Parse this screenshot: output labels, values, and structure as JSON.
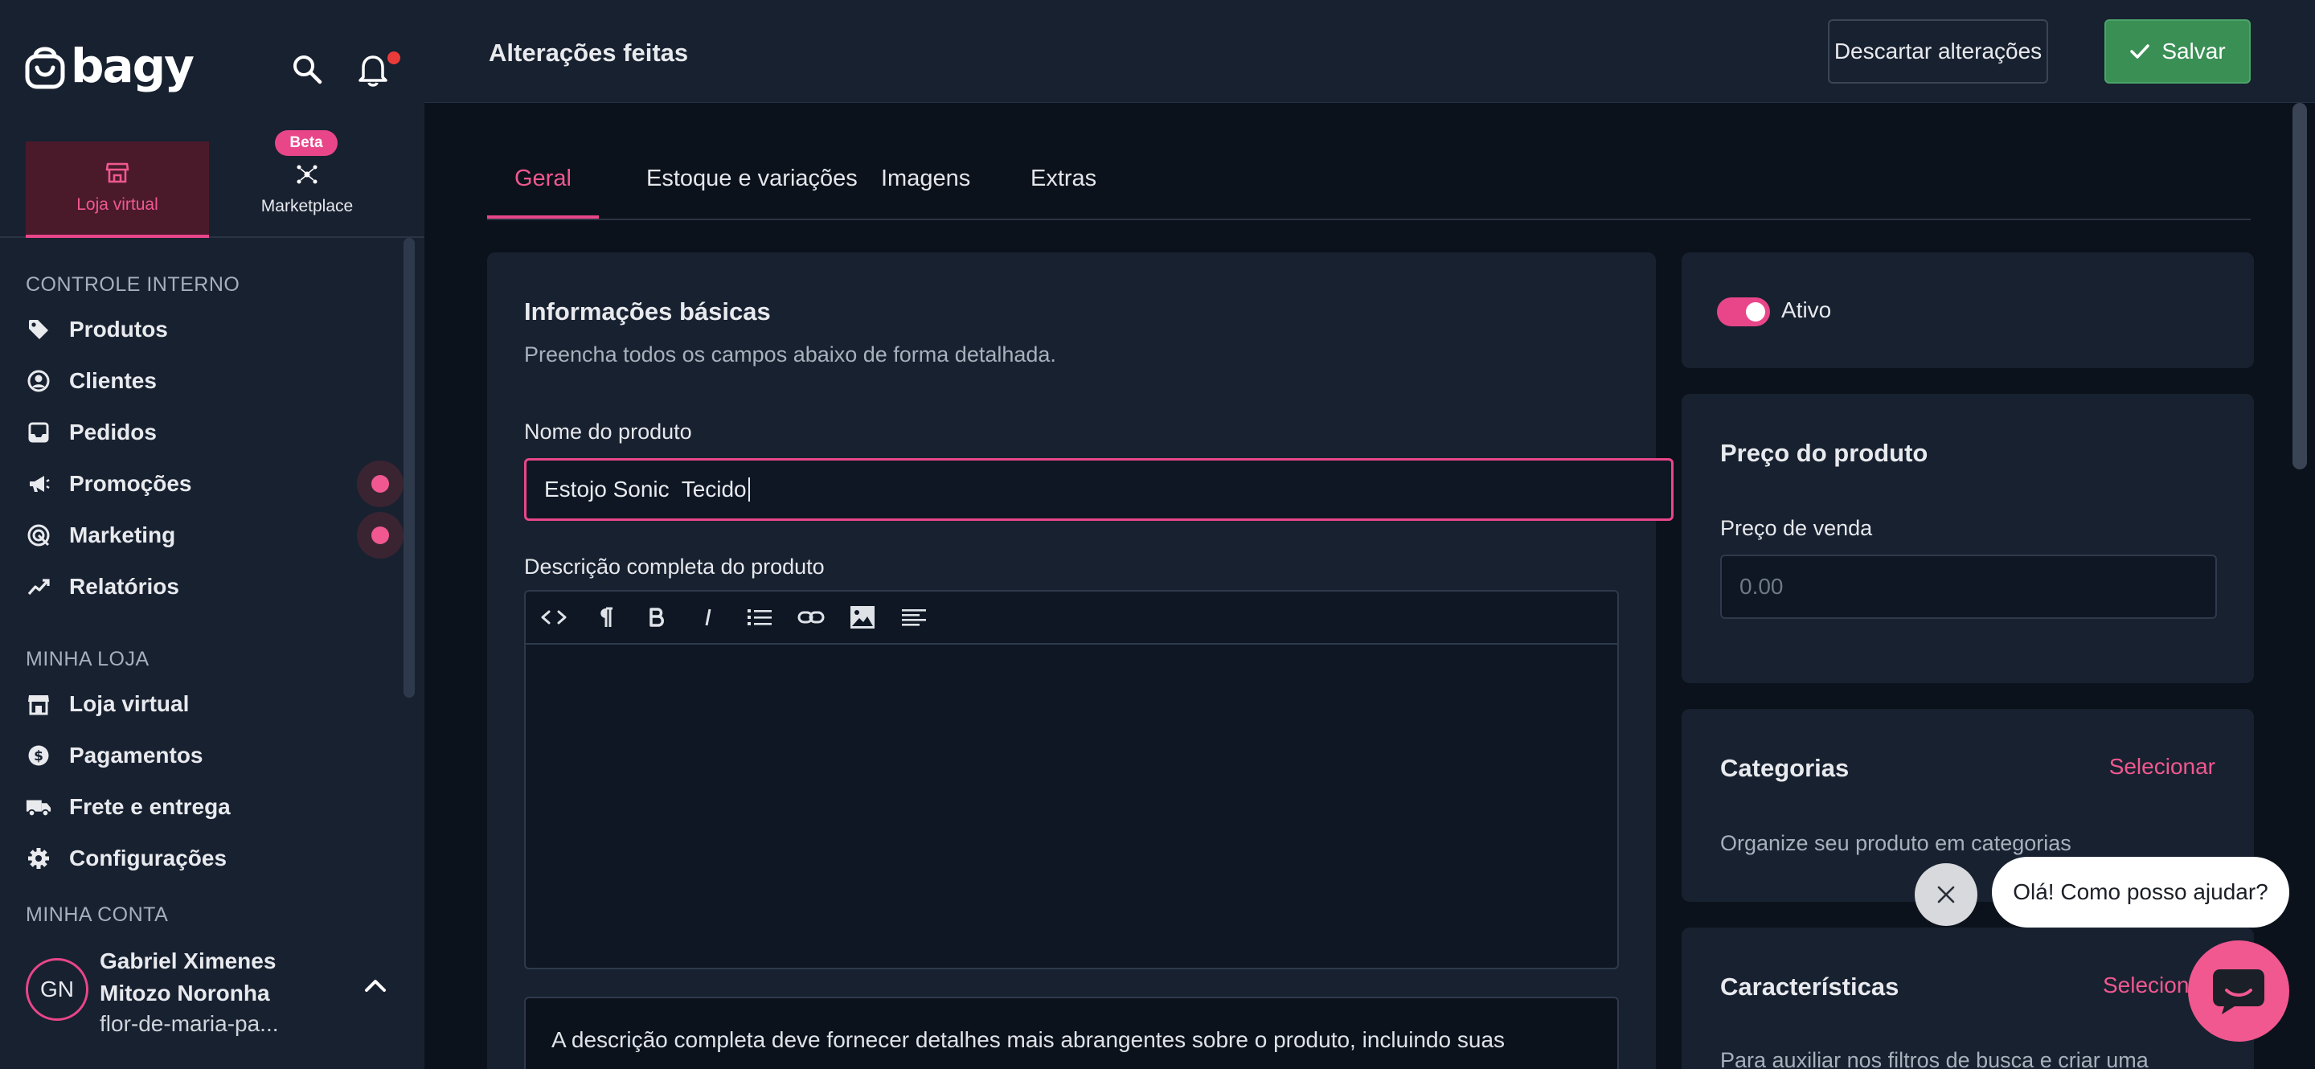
{
  "sidebar": {
    "logo_text": "bagy",
    "modes": [
      {
        "label": "Loja virtual",
        "active": true
      },
      {
        "label": "Marketplace",
        "active": false,
        "badge": "Beta"
      }
    ],
    "sections": [
      {
        "title": "CONTROLE INTERNO",
        "items": [
          {
            "label": "Produtos",
            "icon": "tag-icon"
          },
          {
            "label": "Clientes",
            "icon": "user-circle-icon"
          },
          {
            "label": "Pedidos",
            "icon": "inbox-icon"
          },
          {
            "label": "Promoções",
            "icon": "megaphone-icon",
            "dot": true
          },
          {
            "label": "Marketing",
            "icon": "target-icon",
            "dot": true
          },
          {
            "label": "Relatórios",
            "icon": "trend-icon"
          }
        ]
      },
      {
        "title": "MINHA LOJA",
        "items": [
          {
            "label": "Loja virtual",
            "icon": "store-icon"
          },
          {
            "label": "Pagamentos",
            "icon": "dollar-icon"
          },
          {
            "label": "Frete e entrega",
            "icon": "truck-icon"
          },
          {
            "label": "Configurações",
            "icon": "gear-icon"
          }
        ]
      },
      {
        "title": "MINHA CONTA",
        "items": []
      }
    ],
    "account": {
      "initials": "GN",
      "name": "Gabriel Ximenes Mitozo Noronha",
      "store": "flor-de-maria-pa..."
    }
  },
  "header": {
    "title": "Alterações feitas",
    "discard_label": "Descartar alterações",
    "save_label": "Salvar"
  },
  "tabs": [
    {
      "label": "Geral",
      "active": true
    },
    {
      "label": "Estoque e variações",
      "active": false
    },
    {
      "label": "Imagens",
      "active": false
    },
    {
      "label": "Extras",
      "active": false
    }
  ],
  "basic_info": {
    "title": "Informações básicas",
    "subtitle": "Preencha todos os campos abaixo de forma detalhada.",
    "name_label": "Nome do produto",
    "name_value": "Estojo Sonic  Tecido",
    "description_label": "Descrição completa do produto",
    "description_value": "",
    "toolbar": [
      "code-icon",
      "paragraph-icon",
      "bold-icon",
      "italic-icon",
      "list-icon",
      "link-icon",
      "image-icon",
      "align-icon"
    ],
    "help_text": "A descrição completa deve fornecer detalhes mais abrangentes sobre o produto, incluindo suas"
  },
  "status": {
    "label": "Ativo",
    "active": true
  },
  "price": {
    "title": "Preço do produto",
    "sale_label": "Preço de venda",
    "sale_placeholder": "0.00"
  },
  "categories": {
    "title": "Categorias",
    "action": "Selecionar",
    "subtitle": "Organize seu produto em categorias"
  },
  "characteristics": {
    "title": "Características",
    "action": "Selecionar",
    "subtitle": "Para auxiliar nos filtros de busca e criar uma"
  },
  "chat": {
    "greeting": "Olá! Como posso ajudar?"
  },
  "colors": {
    "accent": "#e9468a",
    "save": "#3a8f55",
    "background": "#0c121c",
    "panel": "#182130"
  }
}
